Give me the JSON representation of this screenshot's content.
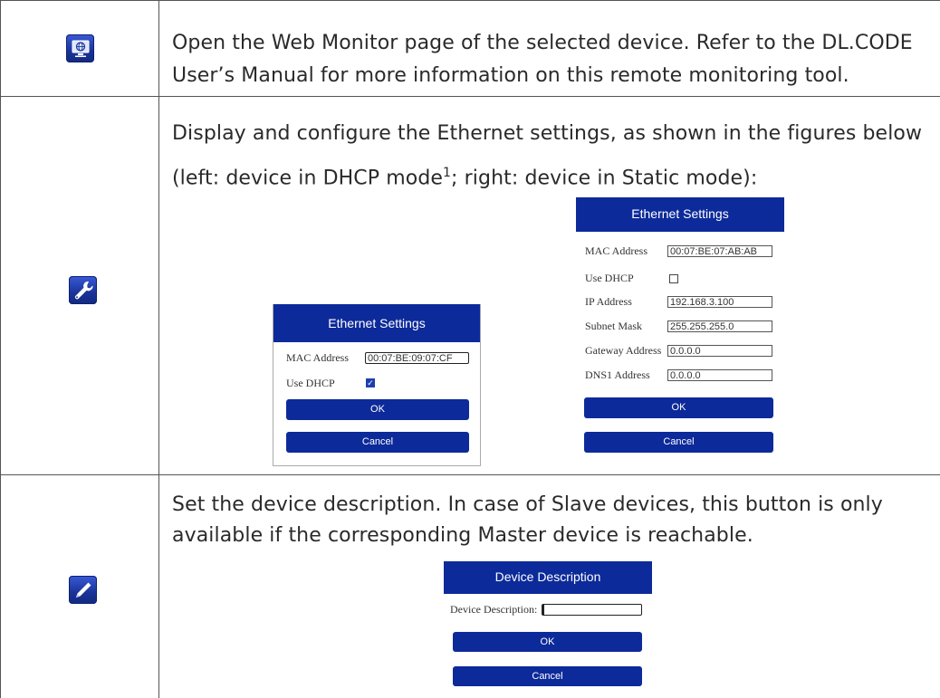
{
  "rows": [
    {
      "icon": "web-monitor-icon",
      "text": "Open the Web Monitor page of the selected device. Refer to the DL.CODE User’s Manual for more information on this remote monitoring tool."
    },
    {
      "icon": "wrench-settings-icon",
      "text_line1": "Display and configure the Ethernet settings, as shown in the figures below",
      "text_line2_pre": "(left: device in DHCP mode",
      "text_line2_sup": "1",
      "text_line2_post": "; right: device in Static mode):",
      "dialog_dhcp": {
        "title": "Ethernet Settings",
        "mac_label": "MAC Address",
        "mac_value": "00:07:BE:09:07:CF",
        "dhcp_label": "Use DHCP",
        "dhcp_checked": true,
        "ok_label": "OK",
        "cancel_label": "Cancel"
      },
      "dialog_static": {
        "title": "Ethernet Settings",
        "mac_label": "MAC Address",
        "mac_value": "00:07:BE:07:AB:AB",
        "dhcp_label": "Use DHCP",
        "dhcp_checked": false,
        "ip_label": "IP Address",
        "ip_value": "192.168.3.100",
        "subnet_label": "Subnet Mask",
        "subnet_value": "255.255.255.0",
        "gateway_label": "Gateway Address",
        "gateway_value": "0.0.0.0",
        "dns_label": "DNS1 Address",
        "dns_value": "0.0.0.0",
        "ok_label": "OK",
        "cancel_label": "Cancel"
      }
    },
    {
      "icon": "pencil-edit-icon",
      "text_line1": "Set the device description. In case of Slave devices, this button is only",
      "text_line2": "available if the corresponding Master device is reachable.",
      "dialog_desc": {
        "title": "Device Description",
        "desc_label": "Device Description:",
        "desc_value": "",
        "ok_label": "OK",
        "cancel_label": "Cancel"
      }
    }
  ],
  "colors": {
    "dialog_blue": "#0d2a9a",
    "icon_blue": "#1a3398",
    "grid": "#555555"
  }
}
